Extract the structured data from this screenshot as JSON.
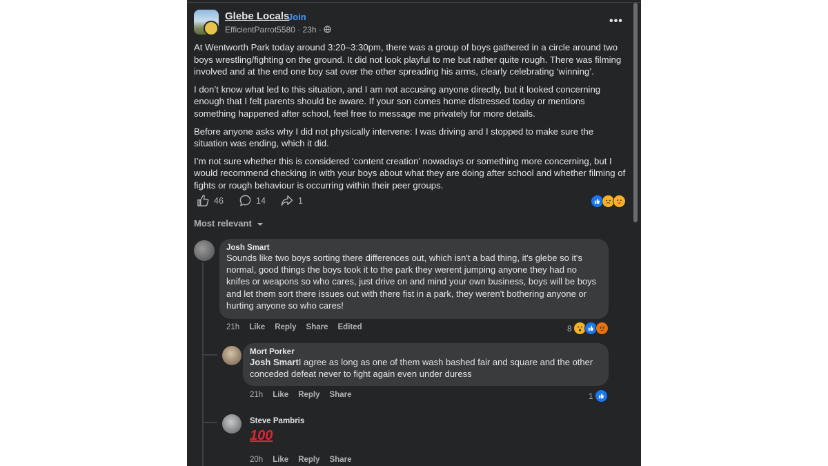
{
  "post": {
    "group_name": "Glebe Locals",
    "join_separator": "·",
    "join_label": "Join",
    "author": "EfficientParrot5580",
    "time": "23h",
    "meta_separator": "·",
    "more_label": "•••",
    "paragraphs": [
      "At Wentworth Park today around 3:20–3:30pm, there was a group of boys gathered in a circle around two boys wrestling/fighting on the ground. It did not look playful to me but rather quite rough. There was filming involved and at the end one boy sat over the other spreading his arms, clearly celebrating ‘winning’.",
      "I don’t know what led to this situation, and I am not accusing anyone directly, but it looked concerning enough that I felt parents should be aware. If your son comes home distressed today or mentions something happened after school, feel free to message me privately for more details.",
      "Before anyone asks why I did not physically intervene: I was driving and I stopped to make sure the situation was ending, which it did.",
      "I’m not sure whether this is considered ‘content creation’ nowadays or something more concerning, but I would recommend checking in with your boys about what they are doing after school and whether filming of fights or rough behaviour is occurring within their peer groups."
    ],
    "likes": "46",
    "comments": "14",
    "shares": "1",
    "reaction_icons": [
      "like-reaction",
      "sad-reaction",
      "care-reaction"
    ]
  },
  "sort": {
    "label": "Most relevant"
  },
  "comments": [
    {
      "name": "Josh Smart",
      "text": "Sounds like two boys sorting there differences out, which isn't a bad thing, it's glebe so it's normal, good things the boys took it to the park they werent jumping anyone they had no knifes or weapons so who cares, just drive on and mind your own business, boys will be boys and let them sort there issues out with there fist in a park, they weren't bothering anyone or hurting anyone so who cares!",
      "time": "21h",
      "like": "Like",
      "reply": "Reply",
      "share": "Share",
      "edited": "Edited",
      "reaction_count": "8"
    },
    {
      "name": "Mort Porker",
      "mention": "Josh Smart",
      "text": "I agree as long as one of them wash bashed fair and square and the other conceded defeat never to fight again even under duress",
      "time": "21h",
      "like": "Like",
      "reply": "Reply",
      "share": "Share",
      "reaction_count": "1"
    },
    {
      "name": "Steve Pambris",
      "text": "100",
      "time": "20h",
      "like": "Like",
      "reply": "Reply",
      "share": "Share"
    }
  ],
  "colors": {
    "background": "#242526",
    "bubble": "#3a3b3c",
    "accent": "#4599ff",
    "like_blue": "#1877f2"
  }
}
